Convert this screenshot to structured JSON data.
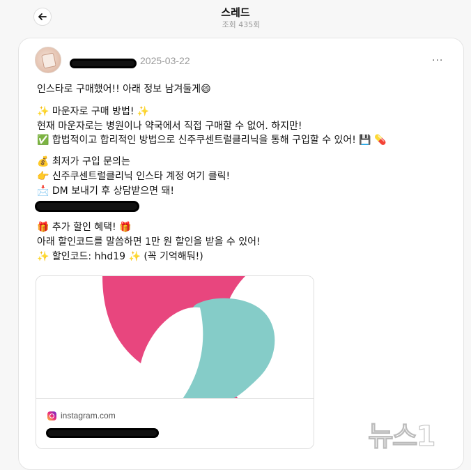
{
  "header": {
    "title": "스레드",
    "views": "조회 435회"
  },
  "post": {
    "date": "2025-03-22",
    "more_label": "···",
    "lines": [
      "인스타로 구매했어!! 아래 정보 남겨둘게😄",
      "✨ 마운자로 구매 방법! ✨",
      "현재 마운자로는 병원이나 약국에서 직접 구매할 수 없어. 하지만!",
      "✅ 합법적이고 합리적인 방법으로 신주쿠센트럴클리닉을 통해 구입할 수 있어! 💾 💊",
      "💰 최저가 구입 문의는",
      "👉 신주쿠센트럴클리닉 인스타 계정 여기 클릭!",
      "📩 DM 보내기 후 상담받으면 돼!",
      "🎁 추가 할인 혜택! 🎁",
      "아래 할인코드를 말씀하면 1만 원 할인을 받을 수 있어!",
      "✨ 할인코드: hhd19 ✨ (꼭 기억해둬!)"
    ]
  },
  "link_preview": {
    "domain": "instagram.com",
    "colors": {
      "pink": "#e8467e",
      "teal": "#85ccc8"
    }
  },
  "watermark": {
    "text": "뉴스1"
  }
}
